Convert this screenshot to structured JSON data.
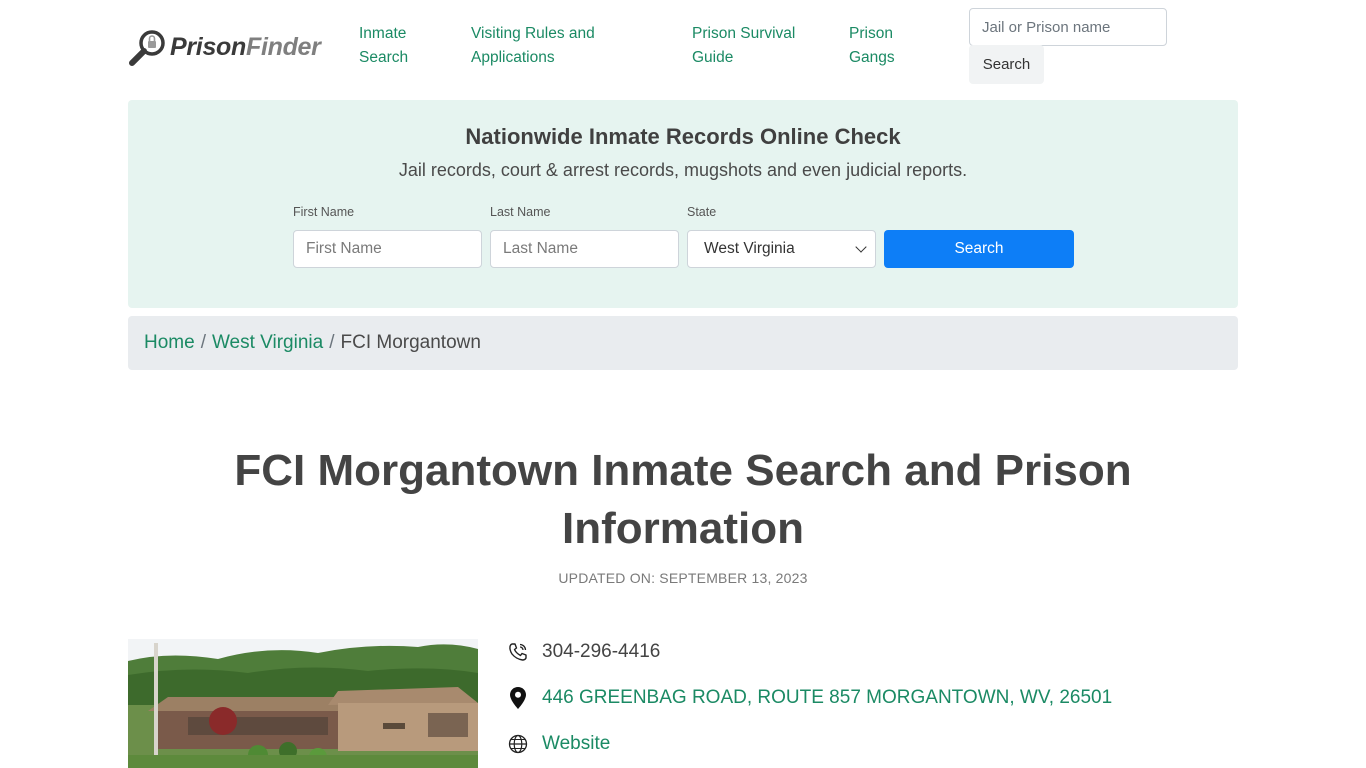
{
  "header": {
    "logo": {
      "word1": "Prison",
      "word2": "Finder"
    },
    "nav": [
      {
        "line1": "Inmate",
        "line2": "Search"
      },
      {
        "line1": "Visiting Rules and",
        "line2": "Applications"
      },
      {
        "line1": "Prison Survival",
        "line2": "Guide"
      },
      {
        "line1": "Prison",
        "line2": "Gangs"
      }
    ],
    "search": {
      "placeholder": "Jail or Prison name",
      "button": "Search"
    }
  },
  "panel": {
    "title": "Nationwide Inmate Records Online Check",
    "subtitle": "Jail records, court & arrest records, mugshots and even judicial reports.",
    "first_name": {
      "label": "First Name",
      "placeholder": "First Name"
    },
    "last_name": {
      "label": "Last Name",
      "placeholder": "Last Name"
    },
    "state": {
      "label": "State",
      "value": "West Virginia"
    },
    "button": "Search"
  },
  "breadcrumb": {
    "home": "Home",
    "sep": "/",
    "state": "West Virginia",
    "current": "FCI Morgantown"
  },
  "page": {
    "title_line1": "FCI Morgantown Inmate Search and Prison",
    "title_line2": "Information",
    "updated": "UPDATED ON: SEPTEMBER 13, 2023"
  },
  "contact": {
    "phone": "304-296-4416",
    "address": "446 GREENBAG ROAD, ROUTE 857 MORGANTOWN, WV, 26501",
    "website": "Website"
  },
  "colors": {
    "link_green": "#1b8a64",
    "panel_bg": "#e6f4f0",
    "primary_button": "#0d7ef7"
  }
}
